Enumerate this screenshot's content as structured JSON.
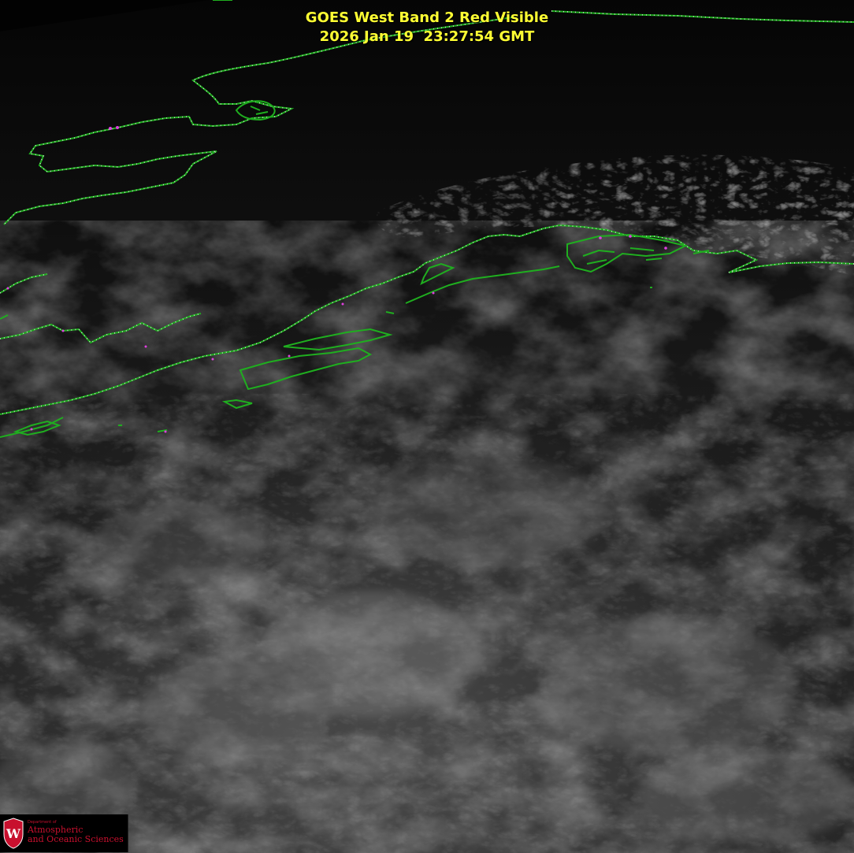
{
  "title": {
    "line1": "GOES West Band 2 Red Visible",
    "line2": "2026 Jan 19  23:27:54 GMT"
  },
  "colors": {
    "title": "#ffff33",
    "coastline": "#1fae1f",
    "border_dots": "#d8d8d8",
    "accent_dots": "#e040e0",
    "logo_text": "#c8102e"
  },
  "logo": {
    "department": "Department of",
    "line1": "Atmospheric",
    "line2": "and Oceanic Sciences",
    "seal_letter": "W"
  }
}
